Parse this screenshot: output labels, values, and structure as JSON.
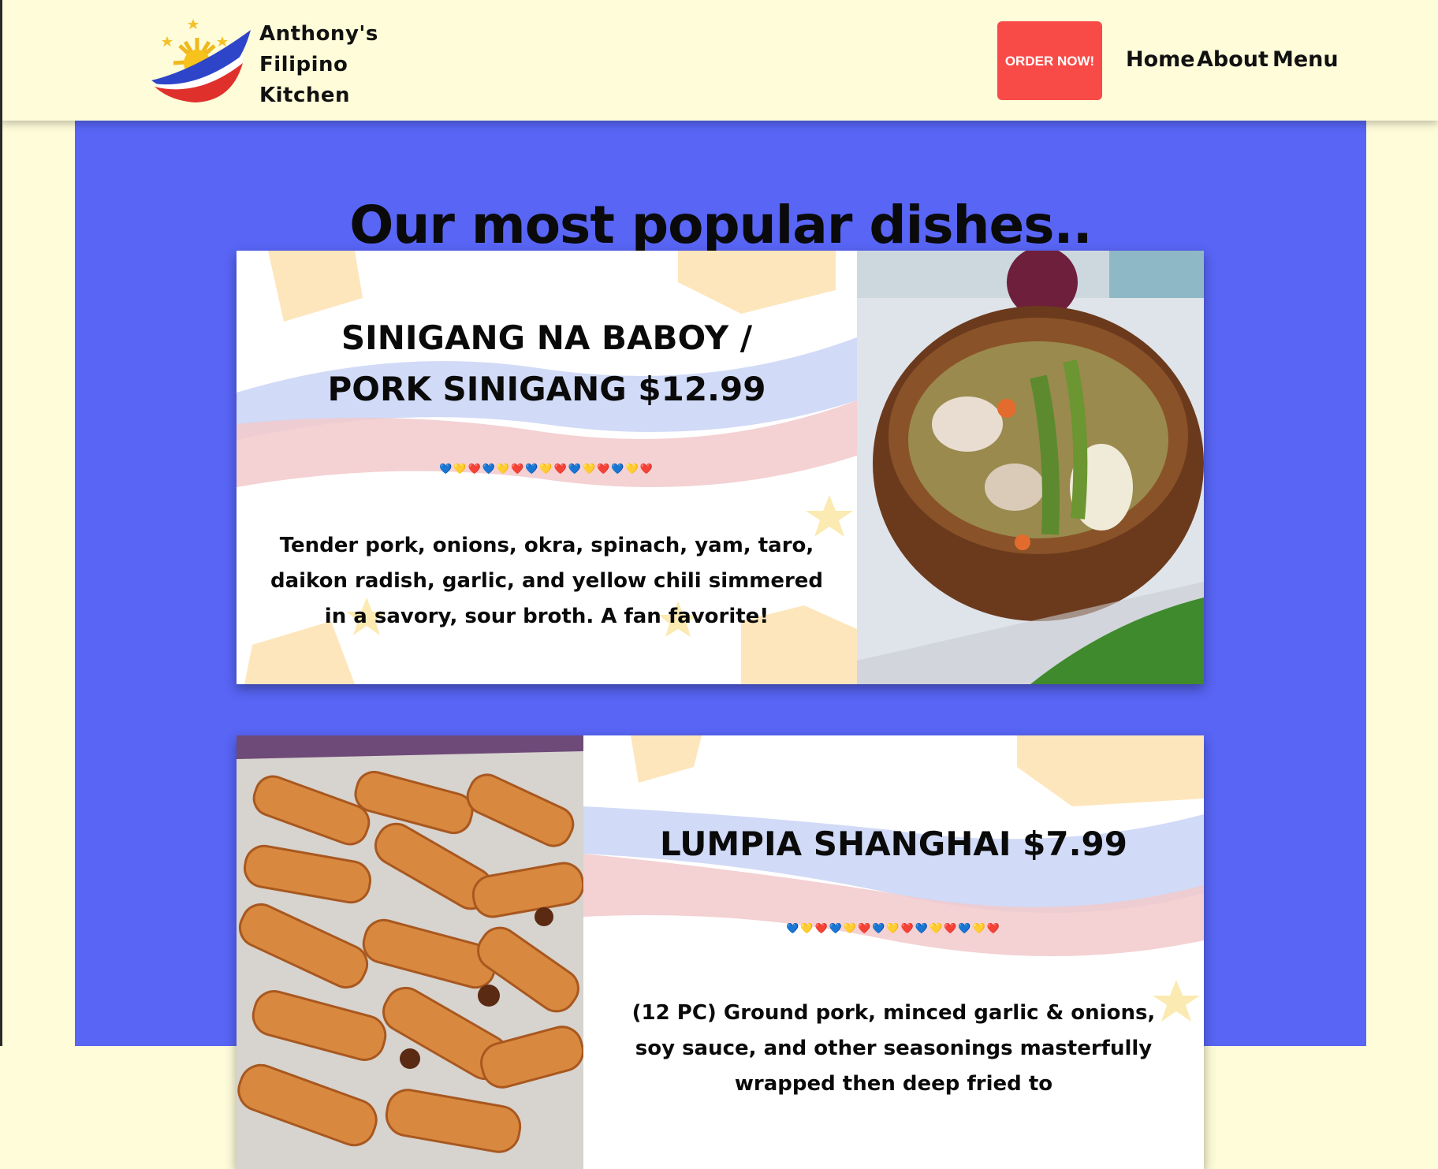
{
  "header": {
    "brand_lines": [
      "Anthony's",
      "Filipino",
      "Kitchen"
    ],
    "order_button": "ORDER NOW!",
    "nav": [
      "Home",
      "About",
      "Menu"
    ]
  },
  "main": {
    "title": "Our most popular dishes..",
    "dishes": [
      {
        "title": "SINIGANG NA BABOY / PORK SINIGANG $12.99",
        "hearts": "💙💛❤️💙💛❤️💙💛❤️💙💛❤️💙💛❤️",
        "description": "Tender pork, onions, okra, spinach, yam, taro, daikon radish, garlic, and yellow chili simmered in a savory, sour broth. A fan favorite!",
        "image": "sinigang-bowl"
      },
      {
        "title": "LUMPIA SHANGHAI $7.99",
        "hearts": "💙💛❤️💙💛❤️💙💛❤️💙💛❤️💙💛❤️",
        "description": "(12 PC) Ground pork, minced garlic & onions, soy sauce, and other seasonings masterfully wrapped then deep fried to",
        "image": "lumpia-tray"
      }
    ]
  },
  "colors": {
    "header_bg": "#fefcd9",
    "main_bg": "#5865f5",
    "order_btn": "#f84b47"
  }
}
